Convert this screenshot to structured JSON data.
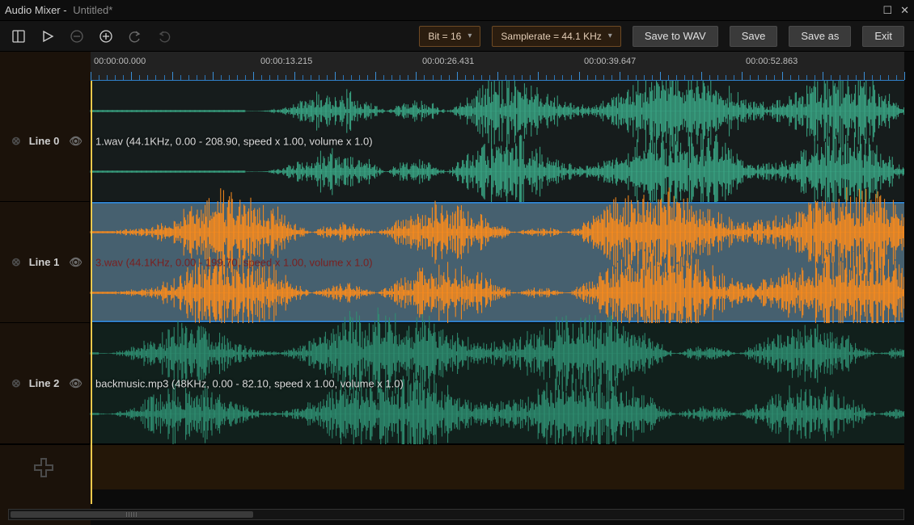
{
  "app": {
    "title": "Audio Mixer -",
    "document": "Untitled*"
  },
  "window": {
    "maximize_glyph": "☐",
    "close_glyph": "✕"
  },
  "toolbar": {
    "bit_label": "Bit = 16",
    "samplerate_label": "Samplerate = 44.1 KHz",
    "save_wav": "Save to WAV",
    "save": "Save",
    "save_as": "Save as",
    "exit": "Exit"
  },
  "ruler": {
    "labels": [
      "00:00:00.000",
      "00:00:13.215",
      "00:00:26.431",
      "00:00:39.647",
      "00:00:52.863"
    ]
  },
  "tracks": [
    {
      "name": "Line 0",
      "clip": "1.wav  (44.1KHz, 0.00 - 208.90, speed x 1.00, volume x 1.0)",
      "color": "#3aa785",
      "selected": false,
      "bg": "bg-a",
      "seed": 11
    },
    {
      "name": "Line 1",
      "clip": "3.wav  (44.1KHz, 0.00 - 199.70, speed x 1.00, volume x 1.0)",
      "color": "#ff8c1a",
      "selected": true,
      "bg": "bg-sel",
      "seed": 23
    },
    {
      "name": "Line 2",
      "clip": "backmusic.mp3  (48KHz, 0.00 - 82.10, speed x 1.00, volume x 1.0)",
      "color": "#2f8f72",
      "selected": false,
      "bg": "bg-b",
      "seed": 37
    }
  ],
  "colors": {
    "playhead": "#f2c94c",
    "ruler_blue": "#2f7fc7"
  }
}
